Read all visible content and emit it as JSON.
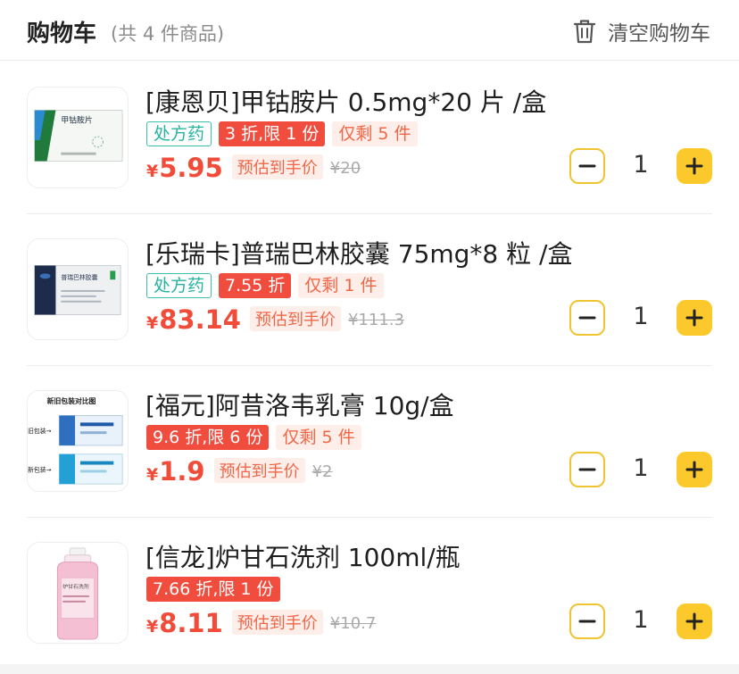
{
  "header": {
    "title": "购物车",
    "count_text": "(共 4 件商品)",
    "clear_label": "清空购物车",
    "clear_icon": "trash-icon"
  },
  "colors": {
    "accent_yellow": "#fcc92c",
    "price_red": "#f14c3a",
    "rx_teal": "#26b3a0",
    "discount_red": "#f04d3f"
  },
  "items": [
    {
      "name": "[康恩贝]甲钴胺片 0.5mg*20 片 /盒",
      "rx_tag": "处方药",
      "discount_tag": "3 折,限 1 份",
      "stock_tag": "仅剩 5 件",
      "currency": "¥",
      "price": "5.95",
      "estimate_label": "预估到手价",
      "original_price": "¥20",
      "quantity": "1",
      "box_text": "甲钴胺片"
    },
    {
      "name": "[乐瑞卡]普瑞巴林胶囊 75mg*8 粒 /盒",
      "rx_tag": "处方药",
      "discount_tag": "7.55 折",
      "stock_tag": "仅剩 1 件",
      "currency": "¥",
      "price": "83.14",
      "estimate_label": "预估到手价",
      "original_price": "¥111.3",
      "quantity": "1",
      "box_text": "普瑞巴林胶囊"
    },
    {
      "name": "[福元]阿昔洛韦乳膏 10g/盒",
      "discount_tag": "9.6 折,限 6 份",
      "stock_tag": "仅剩 5 件",
      "currency": "¥",
      "price": "1.9",
      "estimate_label": "预估到手价",
      "original_price": "¥2",
      "quantity": "1",
      "image_caption": "新旧包装对比图",
      "old_label": "旧包装→",
      "new_label": "新包装→"
    },
    {
      "name": "[信龙]炉甘石洗剂 100ml/瓶",
      "discount_tag": "7.66 折,限 1 份",
      "currency": "¥",
      "price": "8.11",
      "estimate_label": "预估到手价",
      "original_price": "¥10.7",
      "quantity": "1",
      "bottle_label": "炉甘石洗剂"
    }
  ]
}
